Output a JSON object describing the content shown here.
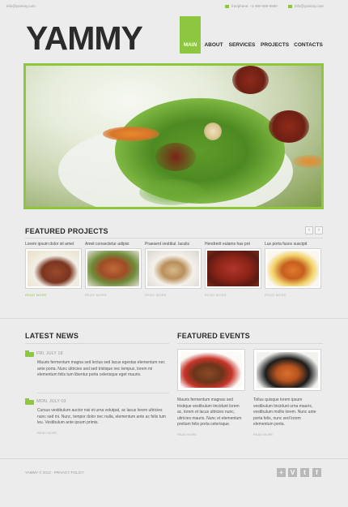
{
  "topbar": {
    "email_left": "info@yammy.com",
    "phone_item": "freephone: +1 800 559 6580",
    "email_right": "info@yammy.com"
  },
  "logo": "YAMMY",
  "nav": [
    {
      "label": "MAIN",
      "active": true
    },
    {
      "label": "ABOUT",
      "active": false
    },
    {
      "label": "SERVICES",
      "active": false
    },
    {
      "label": "PROJECTS",
      "active": false
    },
    {
      "label": "CONTACTS",
      "active": false
    }
  ],
  "featured_projects": {
    "title": "FEATURED PROJECTS",
    "prev": "‹",
    "next": "›",
    "items": [
      {
        "caption": "Lorem ipsum dolor sit amet",
        "more": "READ MORE"
      },
      {
        "caption": "Amet consectetur adipisi",
        "more": "READ MORE"
      },
      {
        "caption": "Praesent vestibul. laculis",
        "more": "READ MORE"
      },
      {
        "caption": "Hendrerit eulams has pot",
        "more": "READ MORE"
      },
      {
        "caption": "Lus porta fusce suscipit",
        "more": "READ MORE"
      }
    ]
  },
  "latest_news": {
    "title": "LATEST NEWS",
    "items": [
      {
        "date": "FRI, JULY 18",
        "body": "Mauris fermentum magna sed lectus sed lacus egestas elementum nec ante porta. Nunc ultricies sed sed tristique nec tempus, lorem mi elementum felis tum libentur porta celerisque eget mauris.",
        "more": "READ MORE"
      },
      {
        "date": "MON, JULY 03",
        "body": "Cursus vestibulum auctor nisi et urna volutpat, ac lacus lorem ultricies nunc sed mi. Nunc, tempor dolor nec nulla, elementum ante ac felis tum leu. Vestibulum ante ipsum primis.",
        "more": "READ MORE"
      }
    ]
  },
  "featured_events": {
    "title": "FEATURED EVENTS",
    "items": [
      {
        "body": "Mauris fermentum magnas sed tristique vestibulum tincidunt lorem ac, lorem et lacus ultricies nunc, ultricies mauris. Nunc et elementum pretium felis porta celerisque.",
        "more": "READ MORE"
      },
      {
        "body": "Tollus quisque lorem ipsum vestibulum tincidunt urna mauris, vestibulum mollis lorem. Nunc ante porta felis, nunc sed lorem elementum porta.",
        "more": "READ MORE"
      }
    ]
  },
  "footer": {
    "copyright": "YAMMY © 2012 · PRIVACY POLICY",
    "social": [
      {
        "icon": "plus-icon",
        "glyph": "+"
      },
      {
        "icon": "vimeo-icon",
        "glyph": "V"
      },
      {
        "icon": "twitter-icon",
        "glyph": "t"
      },
      {
        "icon": "facebook-icon",
        "glyph": "f"
      }
    ]
  },
  "colors": {
    "accent": "#8dc63f",
    "background": "#ececec",
    "text": "#2a2a2a"
  }
}
